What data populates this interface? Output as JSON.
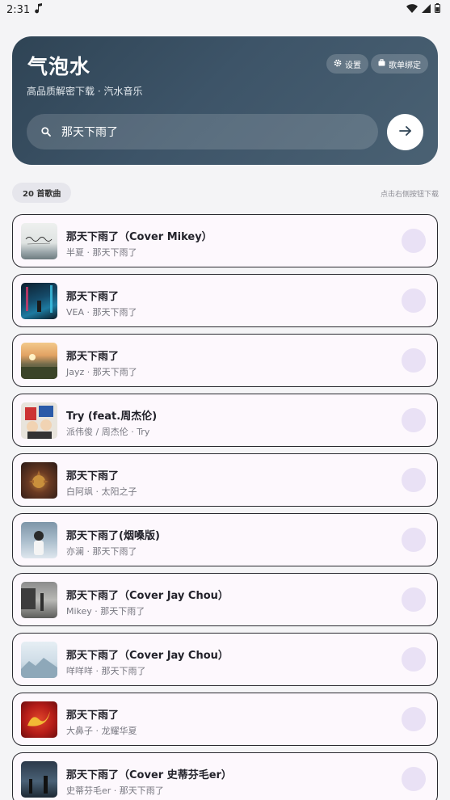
{
  "status_bar": {
    "time": "2:31",
    "icons": [
      "music-note-icon",
      "wifi-icon",
      "signal-icon",
      "battery-icon"
    ]
  },
  "header": {
    "title": "气泡水",
    "subtitle": "高品质解密下载 · 汽水音乐",
    "settings_label": "设置",
    "playlist_bind_label": "歌单绑定",
    "search_value": "那天下雨了",
    "search_icon": "search-icon",
    "go_icon": "arrow-right-icon"
  },
  "list_header": {
    "count_label": "20 首歌曲",
    "hint": "点击右侧按钮下载"
  },
  "songs": [
    {
      "title": "那天下雨了（Cover Mikey）",
      "subtitle": "半夏 · 那天下雨了",
      "cover": "cover-handwriting"
    },
    {
      "title": "那天下雨了",
      "subtitle": "VEA · 那天下雨了",
      "cover": "cover-neon-night"
    },
    {
      "title": "那天下雨了",
      "subtitle": "Jayz · 那天下雨了",
      "cover": "cover-sunset-field"
    },
    {
      "title": "Try (feat.周杰伦)",
      "subtitle": "派伟俊 / 周杰伦 · Try",
      "cover": "cover-comic"
    },
    {
      "title": "那天下雨了",
      "subtitle": "白阿飒 · 太阳之子",
      "cover": "cover-dark-sun"
    },
    {
      "title": "那天下雨了(烟嗓版)",
      "subtitle": "亦澜 · 那天下雨了",
      "cover": "cover-girl-rain"
    },
    {
      "title": "那天下雨了（Cover Jay Chou）",
      "subtitle": "Mikey · 那天下雨了",
      "cover": "cover-gray-street"
    },
    {
      "title": "那天下雨了（Cover Jay Chou）",
      "subtitle": "咩咩咩 · 那天下雨了",
      "cover": "cover-pale-sky"
    },
    {
      "title": "那天下雨了",
      "subtitle": "大鼻子 · 龙耀华夏",
      "cover": "cover-red-dragon"
    },
    {
      "title": "那天下雨了（Cover 史蒂芬毛er）",
      "subtitle": "史蒂芬毛er · 那天下雨了",
      "cover": "cover-blue-night"
    }
  ],
  "colors": {
    "background": "#f4f4f6",
    "hero_gradient_start": "#2f4455",
    "hero_gradient_end": "#4a6173",
    "card_background": "#fdf8fd",
    "card_border": "#2a2a30",
    "download_button": "#e9e1f5"
  }
}
